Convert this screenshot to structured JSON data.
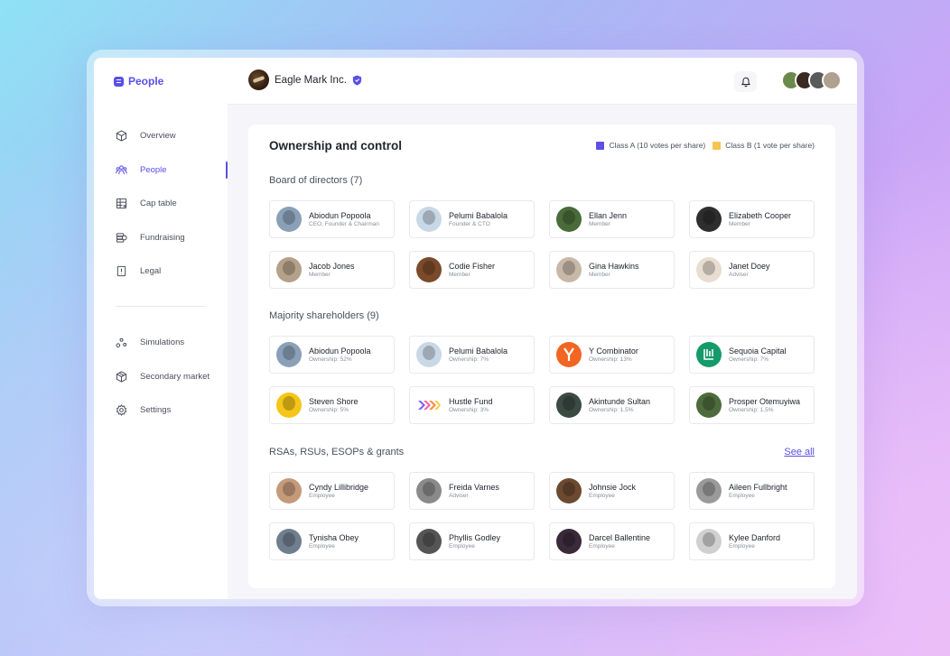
{
  "brand": {
    "name": "People"
  },
  "sidebar": {
    "items": [
      {
        "label": "Overview",
        "icon": "cube-icon"
      },
      {
        "label": "People",
        "icon": "users-icon",
        "active": true
      },
      {
        "label": "Cap table",
        "icon": "table-icon"
      },
      {
        "label": "Fundraising",
        "icon": "coins-icon"
      },
      {
        "label": "Legal",
        "icon": "document-icon"
      }
    ],
    "items2": [
      {
        "label": "Simulations",
        "icon": "nodes-icon"
      },
      {
        "label": "Secondary market",
        "icon": "box-icon"
      },
      {
        "label": "Settings",
        "icon": "gear-icon"
      }
    ]
  },
  "header": {
    "company": "Eagle Mark Inc."
  },
  "main": {
    "title": "Ownership and control",
    "legend": [
      {
        "label": "Class A (10 votes per share)",
        "color": "#5a4fe6"
      },
      {
        "label": "Class B (1 vote per share)",
        "color": "#f5c451"
      }
    ],
    "board": {
      "title": "Board of directors (7)",
      "people": [
        {
          "name": "Abiodun Popoola",
          "sub": "CEO, Founder & Chairman",
          "color": "#8aa0b8"
        },
        {
          "name": "Pelumi Babalola",
          "sub": "Founder & CTO",
          "color": "#c9d8e6"
        },
        {
          "name": "Ellan Jenn",
          "sub": "Member",
          "color": "#4a6b3a"
        },
        {
          "name": "Elizabeth Cooper",
          "sub": "Member",
          "color": "#2e2e2e"
        },
        {
          "name": "Jacob Jones",
          "sub": "Member",
          "color": "#b5a08a"
        },
        {
          "name": "Codie Fisher",
          "sub": "Member",
          "color": "#7a4b2a"
        },
        {
          "name": "Gina Hawkins",
          "sub": "Member",
          "color": "#c8b8a8"
        },
        {
          "name": "Janet Doey",
          "sub": "Adviser",
          "color": "#e8ddd0"
        }
      ]
    },
    "shareholders": {
      "title": "Majority shareholders (9)",
      "people": [
        {
          "name": "Abiodun Popoola",
          "sub": "Ownership: 52%",
          "color": "#8aa0b8",
          "kind": "person"
        },
        {
          "name": "Pelumi Babalola",
          "sub": "Ownership: 7%",
          "color": "#c9d8e6",
          "kind": "person"
        },
        {
          "name": "Y Combinator",
          "sub": "Ownership: 13%",
          "color": "#f26522",
          "kind": "yc"
        },
        {
          "name": "Sequoia Capital",
          "sub": "Ownership: 7%",
          "color": "#159a6a",
          "kind": "sequoia"
        },
        {
          "name": "Steven Shore",
          "sub": "Ownership: 5%",
          "color": "#f5c518",
          "kind": "person"
        },
        {
          "name": "Hustle Fund",
          "sub": "Ownership: 3%",
          "color": "#ffffff",
          "kind": "hustle"
        },
        {
          "name": "Akintunde Sultan",
          "sub": "Ownership: 1.5%",
          "color": "#3c4a44",
          "kind": "person"
        },
        {
          "name": "Prosper Otemuyiwa",
          "sub": "Ownership: 1.5%",
          "color": "#4d6b3d",
          "kind": "person"
        }
      ]
    },
    "grants": {
      "title": "RSAs, RSUs, ESOPs & grants",
      "see_all": "See all",
      "people": [
        {
          "name": "Cyndy Lillibridge",
          "sub": "Employee",
          "color": "#c59a7a"
        },
        {
          "name": "Freida Varnes",
          "sub": "Adviser",
          "color": "#8a8a8a"
        },
        {
          "name": "Johnsie Jock",
          "sub": "Employee",
          "color": "#6b4a30"
        },
        {
          "name": "Aileen Fullbright",
          "sub": "Employee",
          "color": "#9a9a9a"
        },
        {
          "name": "Tynisha Obey",
          "sub": "Employee",
          "color": "#6f7f8e"
        },
        {
          "name": "Phyllis Godley",
          "sub": "Employee",
          "color": "#555555"
        },
        {
          "name": "Darcel Ballentine",
          "sub": "Employee",
          "color": "#3a2a3a"
        },
        {
          "name": "Kylee Danford",
          "sub": "Employee",
          "color": "#d0d0d0"
        }
      ]
    }
  },
  "top_avatars": [
    {
      "color": "#6b8a4a"
    },
    {
      "color": "#3a2a20"
    },
    {
      "color": "#5a5a5a"
    },
    {
      "color": "#b0a090"
    }
  ]
}
